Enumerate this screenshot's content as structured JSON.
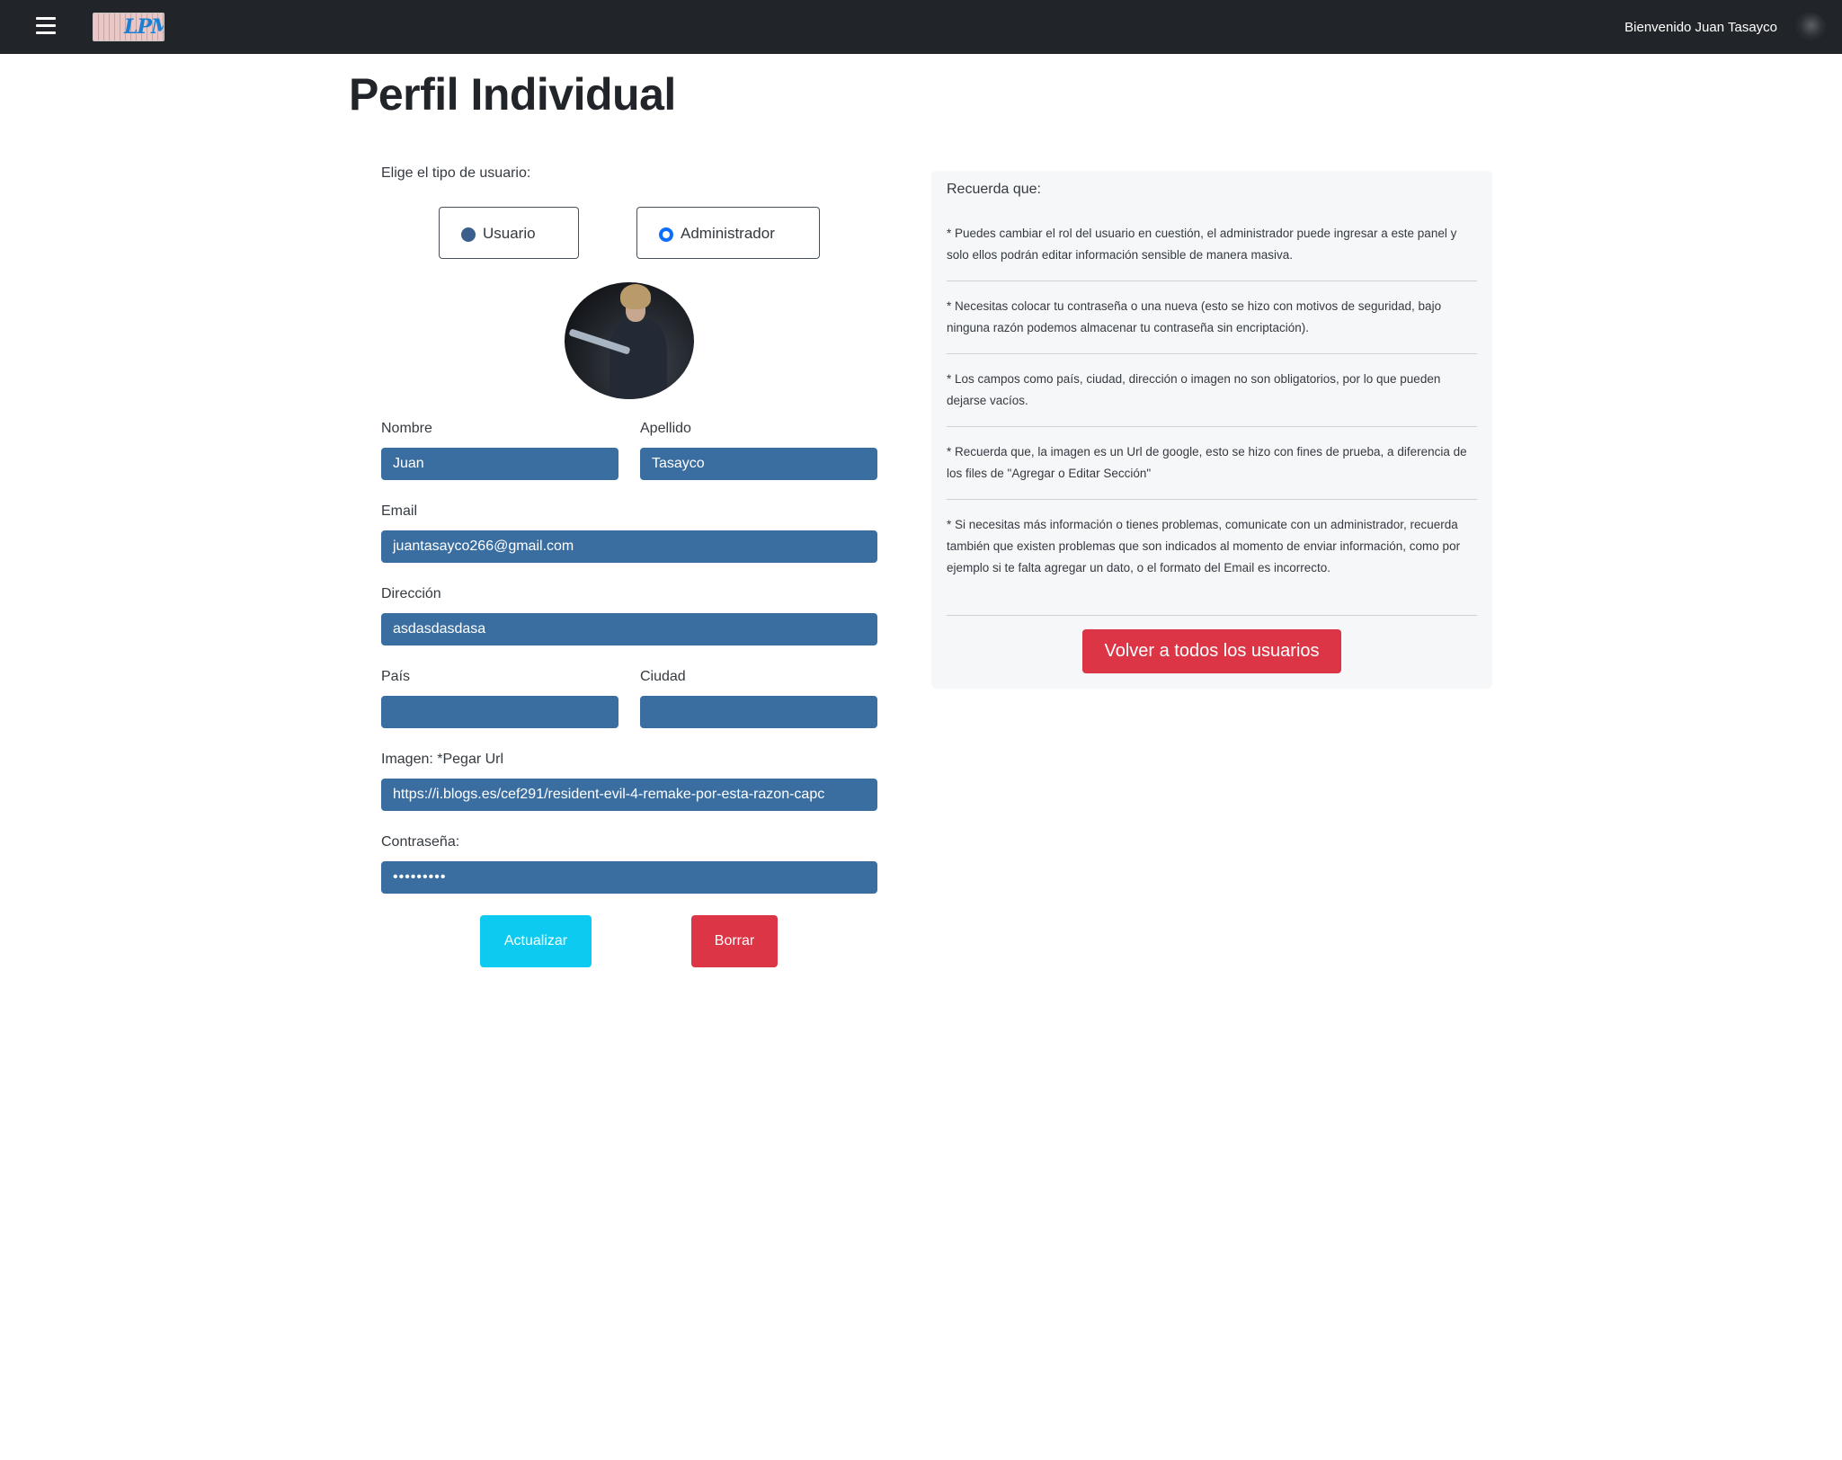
{
  "navbar": {
    "logo_text": "LPM",
    "welcome": "Bienvenido Juan Tasayco"
  },
  "page": {
    "title": "Perfil Individual"
  },
  "form": {
    "role_label": "Elige el tipo de usuario:",
    "roles": [
      {
        "label": "Usuario",
        "selected": false
      },
      {
        "label": "Administrador",
        "selected": true
      }
    ],
    "nombre_label": "Nombre",
    "nombre_value": "Juan",
    "apellido_label": "Apellido",
    "apellido_value": "Tasayco",
    "email_label": "Email",
    "email_value": "juantasayco266@gmail.com",
    "direccion_label": "Dirección",
    "direccion_value": "asdasdasdasa",
    "pais_label": "País",
    "pais_value": "",
    "ciudad_label": "Ciudad",
    "ciudad_value": "",
    "imagen_label": "Imagen: *Pegar Url",
    "imagen_value": "https://i.blogs.es/cef291/resident-evil-4-remake-por-esta-razon-capc",
    "password_label": "Contraseña:",
    "password_value": "•••••••••",
    "update_button": "Actualizar",
    "delete_button": "Borrar"
  },
  "info_panel": {
    "title": "Recuerda que:",
    "notes": [
      "* Puedes cambiar el rol del usuario en cuestión, el administrador puede ingresar a este panel y solo ellos podrán editar información sensible de manera masiva.",
      "* Necesitas colocar tu contraseña o una nueva (esto se hizo con motivos de seguridad, bajo ninguna razón podemos almacenar tu contraseña sin encriptación).",
      "* Los campos como país, ciudad, dirección o imagen no son obligatorios, por lo que pueden dejarse vacíos.",
      "* Recuerda que, la imagen es un Url de google, esto se hizo con fines de prueba, a diferencia de los files de \"Agregar o Editar Sección\"",
      "* Si necesitas más información o tienes problemas, comunicate con un administrador, recuerda también que existen problemas que son indicados al momento de enviar información, como por ejemplo si te falta agregar un dato, o el formato del Email es incorrecto."
    ],
    "back_button": "Volver a todos los usuarios"
  },
  "colors": {
    "navbar_bg": "#212529",
    "input_bg": "#3b6ea0",
    "info_button": "#0dcaf0",
    "danger_button": "#dc3545",
    "radio_checked": "#0d6efd"
  }
}
